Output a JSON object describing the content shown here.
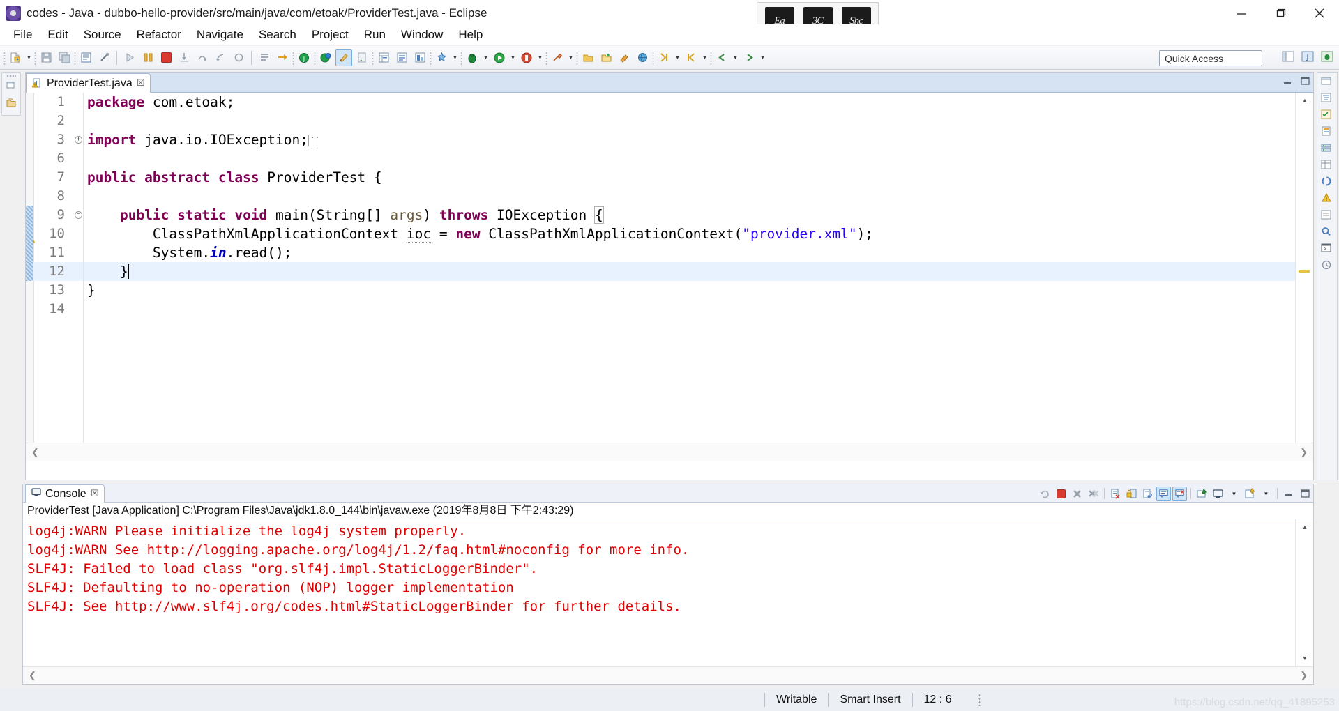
{
  "window": {
    "title": "codes - Java - dubbo-hello-provider/src/main/java/com/etoak/ProviderTest.java - Eclipse",
    "icon": "eclipse-icon",
    "minimize": "—",
    "maximize": "❐",
    "close": "✕"
  },
  "overlay_thumbs": [
    {
      "label": "Ea"
    },
    {
      "label": "3C"
    },
    {
      "label": "Shc"
    }
  ],
  "menu": [
    {
      "label": "File",
      "mnemonic": "F"
    },
    {
      "label": "Edit",
      "mnemonic": "E"
    },
    {
      "label": "Source",
      "mnemonic": "S"
    },
    {
      "label": "Refactor",
      "mnemonic": "t"
    },
    {
      "label": "Navigate",
      "mnemonic": "N"
    },
    {
      "label": "Search",
      "mnemonic": ""
    },
    {
      "label": "Project",
      "mnemonic": "P"
    },
    {
      "label": "Run",
      "mnemonic": "R"
    },
    {
      "label": "Window",
      "mnemonic": "W"
    },
    {
      "label": "Help",
      "mnemonic": "H"
    }
  ],
  "toolbar": {
    "quick_access_placeholder": "Quick Access",
    "buttons": [
      "new-wizard-icon",
      "new-dropdown-arrow",
      "save-icon",
      "save-all-icon",
      "new-java-package-icon",
      "link-icon",
      "run-last-tool-icon",
      "skip-breakpoints-icon",
      "terminate-icon",
      "step-into-icon",
      "step-over-icon",
      "step-return-icon",
      "drop-to-frame-icon",
      "toggle-ant-icon",
      "next-annotation-icon",
      "open-type-icon",
      "search-icon",
      "open-task-icon",
      "new-xml-icon",
      "java-browsing-icon",
      "java-editor-icon",
      "uml-icon",
      "debug-icon",
      "debug-dropdown-arrow",
      "run-icon",
      "run-dropdown-arrow",
      "coverage-icon",
      "coverage-dropdown-arrow",
      "external-tools-icon",
      "external-tools-dropdown-arrow",
      "profile-icon",
      "profile-dropdown-arrow",
      "new-class-icon",
      "new-class-dropdown-arrow",
      "open-resource-icon",
      "search-references-icon",
      "open-perspective-icon",
      "new-folder-icon",
      "new-annotation-icon",
      "globe-icon",
      "next-edit-icon",
      "next-dropdown-arrow",
      "previous-edit-icon",
      "previous-dropdown-arrow",
      "back-icon",
      "forward-icon",
      "forward-dropdown-arrow"
    ],
    "perspective_buttons": [
      "open-perspective-icon",
      "java-perspective-icon",
      "debug-perspective-icon"
    ]
  },
  "editor": {
    "tab": {
      "filename": "ProviderTest.java",
      "icon": "java-file-warning-icon",
      "close": "☒"
    },
    "minimize": "–",
    "maximize": "❐",
    "cursor_position": "12 : 6",
    "lines": [
      {
        "num": "1",
        "indent": 0,
        "marker": "",
        "tokens": [
          {
            "t": "package ",
            "c": "kw"
          },
          {
            "t": "com.etoak;",
            "c": ""
          }
        ]
      },
      {
        "num": "2",
        "indent": 0,
        "marker": "",
        "tokens": []
      },
      {
        "num": "3",
        "indent": 0,
        "marker": "fold-plus",
        "tokens": [
          {
            "t": "import ",
            "c": "kw"
          },
          {
            "t": "java.io.IOException;",
            "c": ""
          },
          {
            "t": "[]",
            "c": "collapse"
          }
        ]
      },
      {
        "num": "6",
        "indent": 0,
        "marker": "",
        "tokens": []
      },
      {
        "num": "7",
        "indent": 0,
        "marker": "",
        "tokens": [
          {
            "t": "public abstract class ",
            "c": "kw"
          },
          {
            "t": "ProviderTest {",
            "c": ""
          }
        ]
      },
      {
        "num": "8",
        "indent": 0,
        "marker": "",
        "tokens": []
      },
      {
        "num": "9",
        "indent": 0,
        "marker": "fold-minus",
        "tokens": [
          {
            "t": "    ",
            "c": ""
          },
          {
            "t": "public static void ",
            "c": "kw"
          },
          {
            "t": "main(String[] ",
            "c": ""
          },
          {
            "t": "args",
            "c": "param"
          },
          {
            "t": ") ",
            "c": ""
          },
          {
            "t": "throws ",
            "c": "kw"
          },
          {
            "t": "IOException ",
            "c": ""
          },
          {
            "t": "{",
            "c": "bracket"
          }
        ]
      },
      {
        "num": "10",
        "indent": 0,
        "marker": "warning",
        "tokens": [
          {
            "t": "        ClassPathXmlApplicationContext ",
            "c": ""
          },
          {
            "t": "ioc",
            "c": "localvar"
          },
          {
            "t": " = ",
            "c": ""
          },
          {
            "t": "new ",
            "c": "kw"
          },
          {
            "t": "ClassPathXmlApplicationContext(",
            "c": ""
          },
          {
            "t": "\"provider.xml\"",
            "c": "str"
          },
          {
            "t": ");",
            "c": ""
          }
        ]
      },
      {
        "num": "11",
        "indent": 0,
        "marker": "",
        "tokens": [
          {
            "t": "        System.",
            "c": ""
          },
          {
            "t": "in",
            "c": "field"
          },
          {
            "t": ".read();",
            "c": ""
          }
        ]
      },
      {
        "num": "12",
        "indent": 0,
        "marker": "",
        "current": true,
        "tokens": [
          {
            "t": "    }",
            "c": ""
          },
          {
            "t": "|",
            "c": "caret"
          }
        ]
      },
      {
        "num": "13",
        "indent": 0,
        "marker": "",
        "tokens": [
          {
            "t": "}",
            "c": ""
          }
        ]
      },
      {
        "num": "14",
        "indent": 0,
        "marker": "",
        "tokens": []
      }
    ]
  },
  "console": {
    "tab_title": "Console",
    "tab_icon": "console-icon",
    "tab_close": "☒",
    "launch_header": "ProviderTest [Java Application] C:\\Program Files\\Java\\jdk1.8.0_144\\bin\\javaw.exe (2019年8月8日 下午2:43:29)",
    "output": [
      "log4j:WARN Please initialize the log4j system properly.",
      "log4j:WARN See http://logging.apache.org/log4j/1.2/faq.html#noconfig for more info.",
      "SLF4J: Failed to load class \"org.slf4j.impl.StaticLoggerBinder\".",
      "SLF4J: Defaulting to no-operation (NOP) logger implementation",
      "SLF4J: See http://www.slf4j.org/codes.html#StaticLoggerBinder for further details."
    ],
    "output_color": "#e00000",
    "toolbar_buttons": [
      "relaunch-icon",
      "terminate-icon",
      "remove-launch-icon",
      "remove-all-terminated-icon",
      "clear-console-icon",
      "scroll-lock-icon",
      "word-wrap-icon",
      "show-console-on-output-icon",
      "show-console-on-error-icon",
      "pin-console-icon",
      "display-selected-console-icon",
      "display-dropdown-arrow",
      "open-console-icon",
      "open-console-dropdown-arrow",
      "minimize-icon",
      "maximize-icon"
    ]
  },
  "statusbar": {
    "writable": "Writable",
    "insert_mode": "Smart Insert",
    "position": "12 : 6",
    "watermark": "https://blog.csdn.net/qq_41895253"
  },
  "colors": {
    "keyword": "#7f0055",
    "string": "#2a00ff",
    "field": "#0000c0",
    "console_error": "#e00000",
    "current_line": "#e8f2fe",
    "tab_strip": "#d6e3f3",
    "accent_selected": "#cfe4f7"
  }
}
